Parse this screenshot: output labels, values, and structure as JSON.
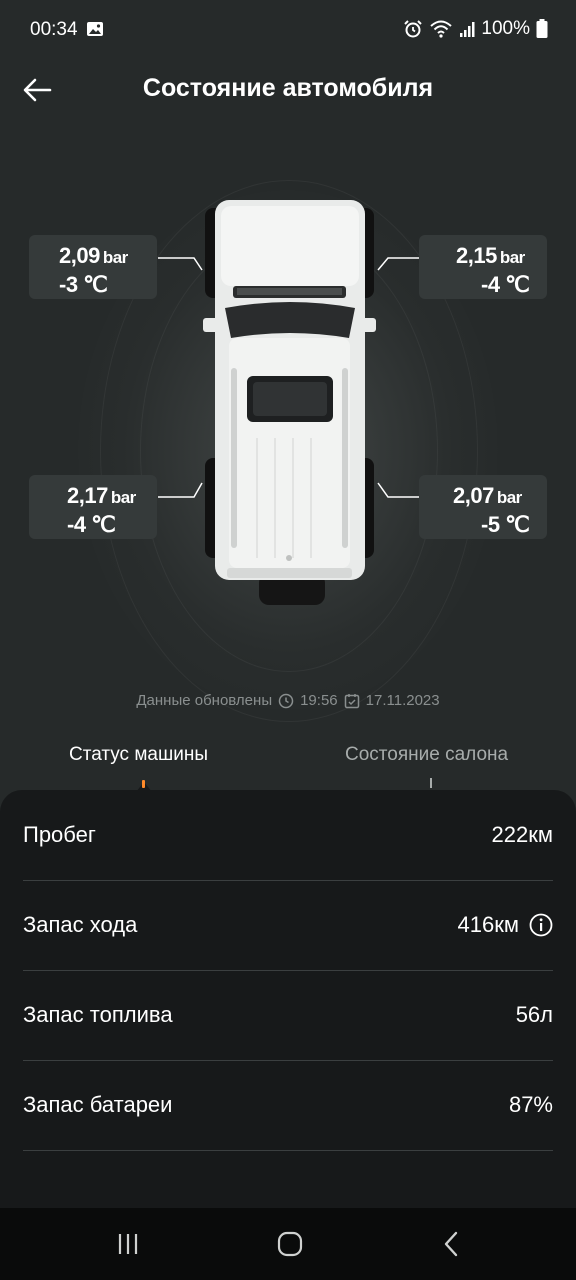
{
  "status_bar": {
    "time": "00:34",
    "battery": "100%",
    "icons": [
      "gallery-icon",
      "alarm-icon",
      "wifi-icon",
      "signal-icon",
      "battery-icon"
    ]
  },
  "header": {
    "title": "Состояние автомобиля",
    "back_icon": "arrow-left-icon"
  },
  "tires": {
    "front_left": {
      "pressure": "2,09",
      "temp": "-3 ℃"
    },
    "front_right": {
      "pressure": "2,15",
      "temp": "-4 ℃"
    },
    "rear_left": {
      "pressure": "2,17",
      "temp": "-4 ℃"
    },
    "rear_right": {
      "pressure": "2,07",
      "temp": "-5 ℃"
    },
    "unit": "bar"
  },
  "updated": {
    "label": "Данные обновлены",
    "time": "19:56",
    "date": "17.11.2023"
  },
  "tabs": [
    {
      "label": "Статус машины",
      "active": true
    },
    {
      "label": "Состояние салона",
      "active": false
    }
  ],
  "stats": [
    {
      "label": "Пробег",
      "value": "222км"
    },
    {
      "label": "Запас хода",
      "value": "416км",
      "info_icon": "info-icon"
    },
    {
      "label": "Запас топлива",
      "value": "56л"
    },
    {
      "label": "Запас батареи",
      "value": "87%"
    }
  ],
  "nav": [
    "recent-apps-icon",
    "home-icon",
    "back-icon"
  ],
  "colors": {
    "background": "#262a2a",
    "panel": "#17191a",
    "card": "#353a3a",
    "accent": "#ff8a2a"
  }
}
